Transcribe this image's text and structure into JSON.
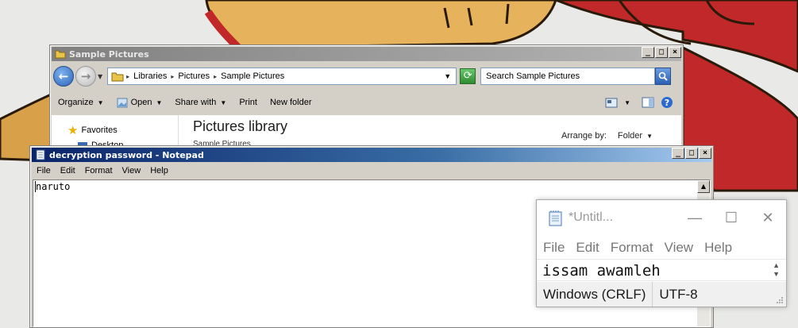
{
  "explorer": {
    "title": "Sample Pictures",
    "breadcrumb": [
      "Libraries",
      "Pictures",
      "Sample Pictures"
    ],
    "search_placeholder": "Search Sample Pictures",
    "commands": {
      "organize": "Organize",
      "open": "Open",
      "share_with": "Share with",
      "print": "Print",
      "new_folder": "New folder"
    },
    "nav": {
      "favorites": "Favorites",
      "desktop": "Desktop"
    },
    "library_title": "Pictures library",
    "library_subtitle": "Sample Pictures",
    "arrange_by_label": "Arrange by:",
    "arrange_by_value": "Folder"
  },
  "notepad": {
    "title": "decryption password - Notepad",
    "menu": [
      "File",
      "Edit",
      "Format",
      "View",
      "Help"
    ],
    "content": "naruto"
  },
  "notepad10": {
    "title": "*Untitl...",
    "menu": [
      "File",
      "Edit",
      "Format",
      "View",
      "Help"
    ],
    "content": "issam awamleh",
    "status_line_ending": "Windows (CRLF)",
    "status_encoding": "UTF-8"
  },
  "colors": {
    "notepad_title_gradient_start": "#0a246a",
    "notepad_title_gradient_end": "#a6caf0",
    "explorer_inactive_title": "#808080",
    "wallpaper_red": "#c0282a",
    "wallpaper_straw": "#d9a04a",
    "desktop_bg": "#e9e9e7"
  },
  "icons": {
    "back": "back-arrow-icon",
    "forward": "forward-arrow-icon",
    "refresh": "refresh-icon",
    "search": "search-icon",
    "favorites": "star-icon",
    "notepad": "notepad-icon"
  }
}
